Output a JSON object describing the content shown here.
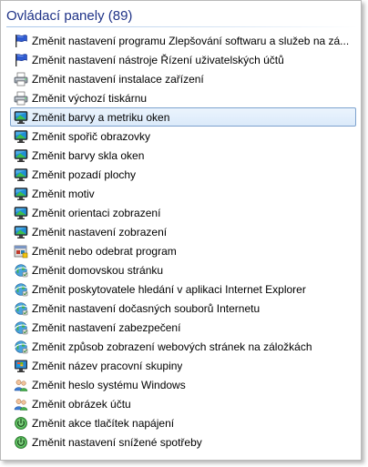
{
  "header": {
    "title": "Ovládací panely (89)"
  },
  "colors": {
    "title": "#1e3287",
    "selection_border": "#7da2ce",
    "selection_fill": "#dbeafa"
  },
  "items": [
    {
      "label": "Změnit nastavení programu Zlepšování softwaru a služeb na zá...",
      "icon": "flag-icon",
      "selected": false
    },
    {
      "label": "Změnit nastavení nástroje Řízení uživatelských účtů",
      "icon": "flag-icon",
      "selected": false
    },
    {
      "label": "Změnit nastavení instalace zařízení",
      "icon": "printer-icon",
      "selected": false
    },
    {
      "label": "Změnit výchozí tiskárnu",
      "icon": "printer-icon",
      "selected": false
    },
    {
      "label": "Změnit barvy a metriku oken",
      "icon": "monitor-icon",
      "selected": true
    },
    {
      "label": "Změnit spořič obrazovky",
      "icon": "monitor-icon",
      "selected": false
    },
    {
      "label": "Změnit barvy skla oken",
      "icon": "monitor-icon",
      "selected": false
    },
    {
      "label": "Změnit pozadí plochy",
      "icon": "monitor-icon",
      "selected": false
    },
    {
      "label": "Změnit motiv",
      "icon": "monitor-icon",
      "selected": false
    },
    {
      "label": "Změnit orientaci zobrazení",
      "icon": "monitor-icon",
      "selected": false
    },
    {
      "label": "Změnit nastavení zobrazení",
      "icon": "monitor-icon",
      "selected": false
    },
    {
      "label": "Změnit nebo odebrat program",
      "icon": "programs-icon",
      "selected": false
    },
    {
      "label": "Změnit domovskou stránku",
      "icon": "internet-options-icon",
      "selected": false
    },
    {
      "label": "Změnit poskytovatele hledání v aplikaci Internet Explorer",
      "icon": "internet-options-icon",
      "selected": false
    },
    {
      "label": "Změnit nastavení dočasných souborů Internetu",
      "icon": "internet-options-icon",
      "selected": false
    },
    {
      "label": "Změnit nastavení zabezpečení",
      "icon": "internet-options-icon",
      "selected": false
    },
    {
      "label": "Změnit způsob zobrazení webových stránek na záložkách",
      "icon": "internet-options-icon",
      "selected": false
    },
    {
      "label": "Změnit název pracovní skupiny",
      "icon": "system-icon",
      "selected": false
    },
    {
      "label": "Změnit heslo systému Windows",
      "icon": "users-icon",
      "selected": false
    },
    {
      "label": "Změnit obrázek účtu",
      "icon": "users-icon",
      "selected": false
    },
    {
      "label": "Změnit akce tlačítek napájení",
      "icon": "power-icon",
      "selected": false
    },
    {
      "label": "Změnit nastavení snížené spotřeby",
      "icon": "power-icon",
      "selected": false
    }
  ]
}
